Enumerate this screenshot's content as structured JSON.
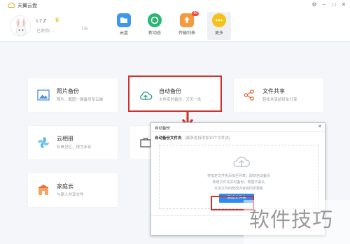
{
  "window": {
    "title": "天翼云盘",
    "buttons": [
      "settings",
      "minimize",
      "maximize",
      "close"
    ]
  },
  "user": {
    "name": "L7 Z",
    "subtitle": "已使用/…",
    "subtitle_extra": "T/B"
  },
  "nav": [
    {
      "label": "云盘",
      "icon": "folder-icon",
      "color": "#3d97ea"
    },
    {
      "label": "新动态",
      "icon": "refresh-icon",
      "color": "#2bb673"
    },
    {
      "label": "传输列表",
      "icon": "upload-icon",
      "color": "#f59a3d",
      "badge": "66"
    },
    {
      "label": "更多",
      "icon": "more-icon",
      "color": "#f5c21a",
      "active": true
    }
  ],
  "cards": [
    {
      "id": "photo-backup",
      "title": "照片备份",
      "desc": "照片、截图一键备份至云端",
      "icon": "photo-icon"
    },
    {
      "id": "auto-backup",
      "title": "自动备份",
      "desc": "文件实时备份，万无一失",
      "icon": "cloud-upload-icon"
    },
    {
      "id": "file-share",
      "title": "文件共享",
      "desc": "轻松共享给好友分享",
      "icon": "share-icon"
    },
    {
      "id": "cloud-album",
      "title": "云相册",
      "desc": "珍贵记忆，视为永存",
      "icon": "pinwheel-icon"
    },
    {
      "id": "hidden-card",
      "title": "",
      "desc": "",
      "icon": "briefcase-icon"
    },
    {
      "id": "family-cloud",
      "title": "家庭云",
      "desc": "与家人共享文件",
      "icon": "house-icon"
    }
  ],
  "dialog": {
    "title": "自动备份",
    "tab_label": "自动备份文件夹",
    "tab_hint": "(最多支持添加10个文件夹)",
    "help_lines": [
      "将指定文件夹添加至列表，即刻自动备份",
      "新增文件夹实时备份，数据不丢失",
      "本地文件的修改内容将同步更新"
    ],
    "add_button": "添加文件夹"
  },
  "watermark": "软件技巧",
  "colors": {
    "accent": "#2d8cf0",
    "highlight": "#d0312d"
  }
}
